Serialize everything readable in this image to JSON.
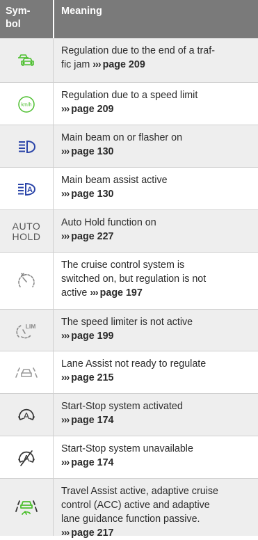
{
  "header": {
    "symbol_label_1": "Sym-",
    "symbol_label_2": "bol",
    "meaning_label": "Meaning"
  },
  "colors": {
    "header_bg": "#7a7a7a",
    "green_indicator": "#4cbf2e",
    "blue_indicator": "#2a44a8",
    "grey_indicator": "#888888",
    "row_alt_bg": "#eeeeee"
  },
  "rows": [
    {
      "icon": "traffic-jam-cars-icon",
      "text_1": "Regulation due to the end of a traf-",
      "text_2": "fic jam",
      "arrows": "›››",
      "ref": "page 209"
    },
    {
      "icon": "speed-limit-kmh-icon",
      "icon_text": "km/h",
      "text_1": "Regulation due to a speed limit",
      "arrows": "›››",
      "ref": "page 209"
    },
    {
      "icon": "main-beam-icon",
      "text_1": "Main beam on or flasher on",
      "arrows": "›››",
      "ref": "page 130"
    },
    {
      "icon": "main-beam-assist-icon",
      "icon_text": "A",
      "text_1": "Main beam assist active",
      "arrows": "›››",
      "ref": "page 130"
    },
    {
      "icon": "auto-hold-icon",
      "icon_text_1": "AUTO",
      "icon_text_2": "HOLD",
      "text_1": "Auto Hold function on",
      "arrows": "›››",
      "ref": "page 227"
    },
    {
      "icon": "cruise-control-icon",
      "text_1": "The cruise control system is",
      "text_2": "switched on, but regulation is not",
      "text_3": "active",
      "arrows": "›››",
      "ref": "page 197"
    },
    {
      "icon": "speed-limiter-icon",
      "icon_text": "LIM",
      "text_1": "The speed limiter is not active",
      "arrows": "›››",
      "ref": "page 199"
    },
    {
      "icon": "lane-assist-icon",
      "text_1": "Lane Assist not ready to regulate",
      "arrows": "›››",
      "ref": "page 215"
    },
    {
      "icon": "start-stop-icon",
      "icon_text": "A",
      "text_1": "Start-Stop system activated",
      "arrows": "›››",
      "ref": "page 174"
    },
    {
      "icon": "start-stop-unavailable-icon",
      "icon_text": "A",
      "text_1": "Start-Stop system unavailable",
      "arrows": "›››",
      "ref": "page 174"
    },
    {
      "icon": "travel-assist-icon",
      "text_1": "Travel Assist active, adaptive cruise",
      "text_2": "control (ACC) active and adaptive",
      "text_3": "lane guidance function passive.",
      "arrows": "›››",
      "ref": "page 217"
    }
  ]
}
